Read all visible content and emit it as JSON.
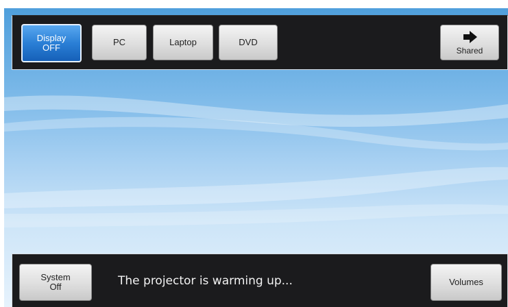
{
  "top_bar": {
    "display_button": {
      "line1": "Display",
      "line2": "OFF"
    },
    "sources": [
      {
        "label": "PC"
      },
      {
        "label": "Laptop"
      },
      {
        "label": "DVD"
      }
    ],
    "shared_button": {
      "label": "Shared",
      "icon": "arrow-right-icon"
    }
  },
  "bottom_bar": {
    "system_button": {
      "line1": "System",
      "line2": "Off"
    },
    "status_message": "The projector is warming up...",
    "volumes_button": {
      "label": "Volumes"
    }
  },
  "colors": {
    "active_button": "#2a7fd6",
    "bar_background": "#1b1b1d",
    "background_top": "#4f9fdc",
    "background_bottom": "#e6f2fc"
  }
}
